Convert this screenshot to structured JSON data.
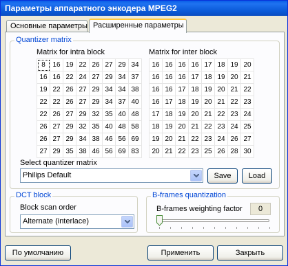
{
  "window": {
    "title": "Параметры аппаратного энкодера MPEG2"
  },
  "tabs": [
    {
      "label": "Основные параметры",
      "active": false
    },
    {
      "label": "Расширенные параметры",
      "active": true
    }
  ],
  "quantizer": {
    "group_label": "Quantizer matrix",
    "intra_label": "Matrix for intra block",
    "inter_label": "Matrix for inter block",
    "intra_matrix": [
      [
        8,
        16,
        19,
        22,
        26,
        27,
        29,
        34
      ],
      [
        16,
        16,
        22,
        24,
        27,
        29,
        34,
        37
      ],
      [
        19,
        22,
        26,
        27,
        29,
        34,
        34,
        38
      ],
      [
        22,
        22,
        26,
        27,
        29,
        34,
        37,
        40
      ],
      [
        22,
        26,
        27,
        29,
        32,
        35,
        40,
        48
      ],
      [
        26,
        27,
        29,
        32,
        35,
        40,
        48,
        58
      ],
      [
        26,
        27,
        29,
        34,
        38,
        46,
        56,
        69
      ],
      [
        27,
        29,
        35,
        38,
        46,
        56,
        69,
        83
      ]
    ],
    "inter_matrix": [
      [
        16,
        16,
        16,
        16,
        17,
        18,
        19,
        20
      ],
      [
        16,
        16,
        16,
        17,
        18,
        19,
        20,
        21
      ],
      [
        16,
        16,
        17,
        18,
        19,
        20,
        21,
        22
      ],
      [
        16,
        17,
        18,
        19,
        20,
        21,
        22,
        23
      ],
      [
        17,
        18,
        19,
        20,
        21,
        22,
        23,
        24
      ],
      [
        18,
        19,
        20,
        21,
        22,
        23,
        24,
        25
      ],
      [
        19,
        20,
        21,
        22,
        23,
        24,
        26,
        27
      ],
      [
        20,
        21,
        22,
        23,
        25,
        26,
        28,
        30
      ]
    ],
    "select_label": "Select quantizer matrix",
    "select_value": "Philips Default",
    "save_label": "Save",
    "load_label": "Load"
  },
  "dct": {
    "group_label": "DCT block",
    "scan_label": "Block scan order",
    "scan_value": "Alternate (interlace)"
  },
  "bframes": {
    "group_label": "B-frames quantization",
    "factor_label": "B-frames weighting factor",
    "factor_value": "0"
  },
  "footer": {
    "default_label": "По умолчанию",
    "apply_label": "Применить",
    "close_label": "Закрыть"
  },
  "colors": {
    "titlebar": "#0a5ee8",
    "group_label": "#0046d5",
    "tab_highlight": "#ffc83c"
  },
  "icons": {
    "combo_arrow": "chevron-down-icon",
    "slider_thumb": "slider-thumb-icon"
  }
}
